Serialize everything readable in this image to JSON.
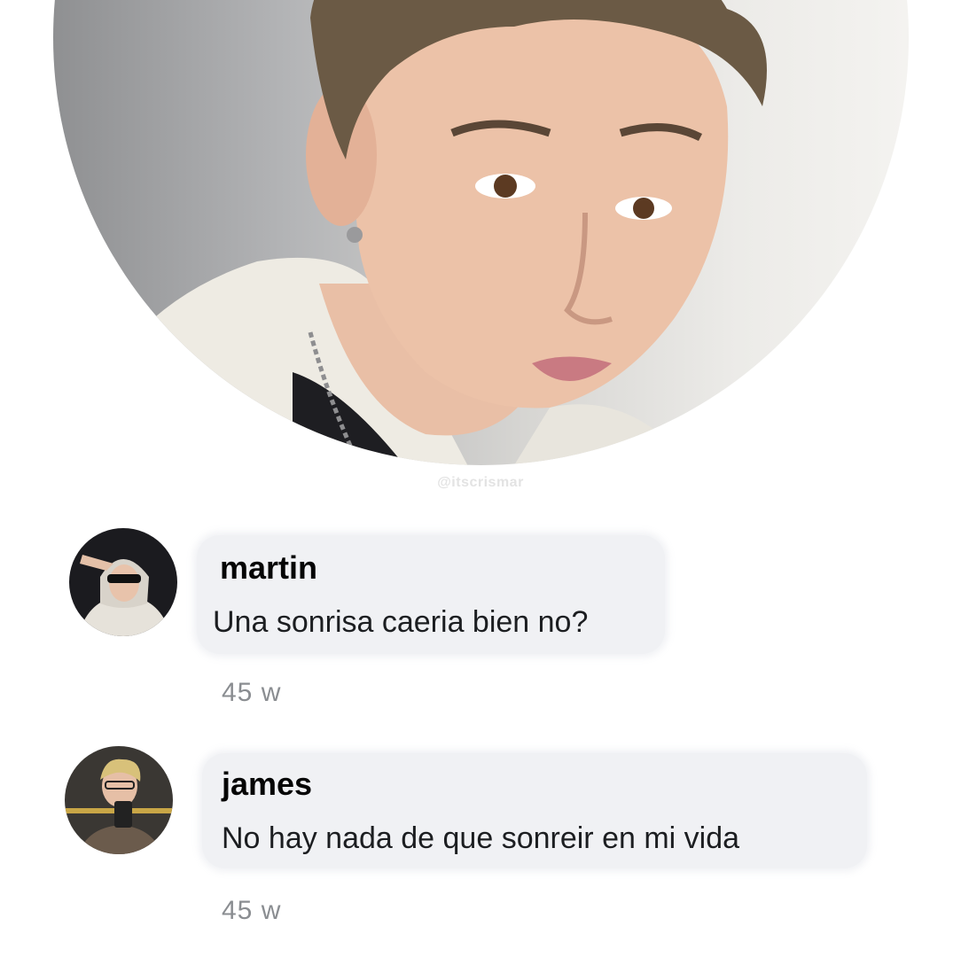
{
  "watermark": "@itscrismar",
  "comments": [
    {
      "username": "martin",
      "text": "Una sonrisa caeria bien no?",
      "time": "45 w"
    },
    {
      "username": "james",
      "text": "No hay nada de que sonreir en mi vida",
      "time": "45 w"
    }
  ],
  "colors": {
    "bubble": "#f0f1f4",
    "username": "#050505",
    "text": "#1c1e21",
    "timestamp": "#8a8d91"
  }
}
